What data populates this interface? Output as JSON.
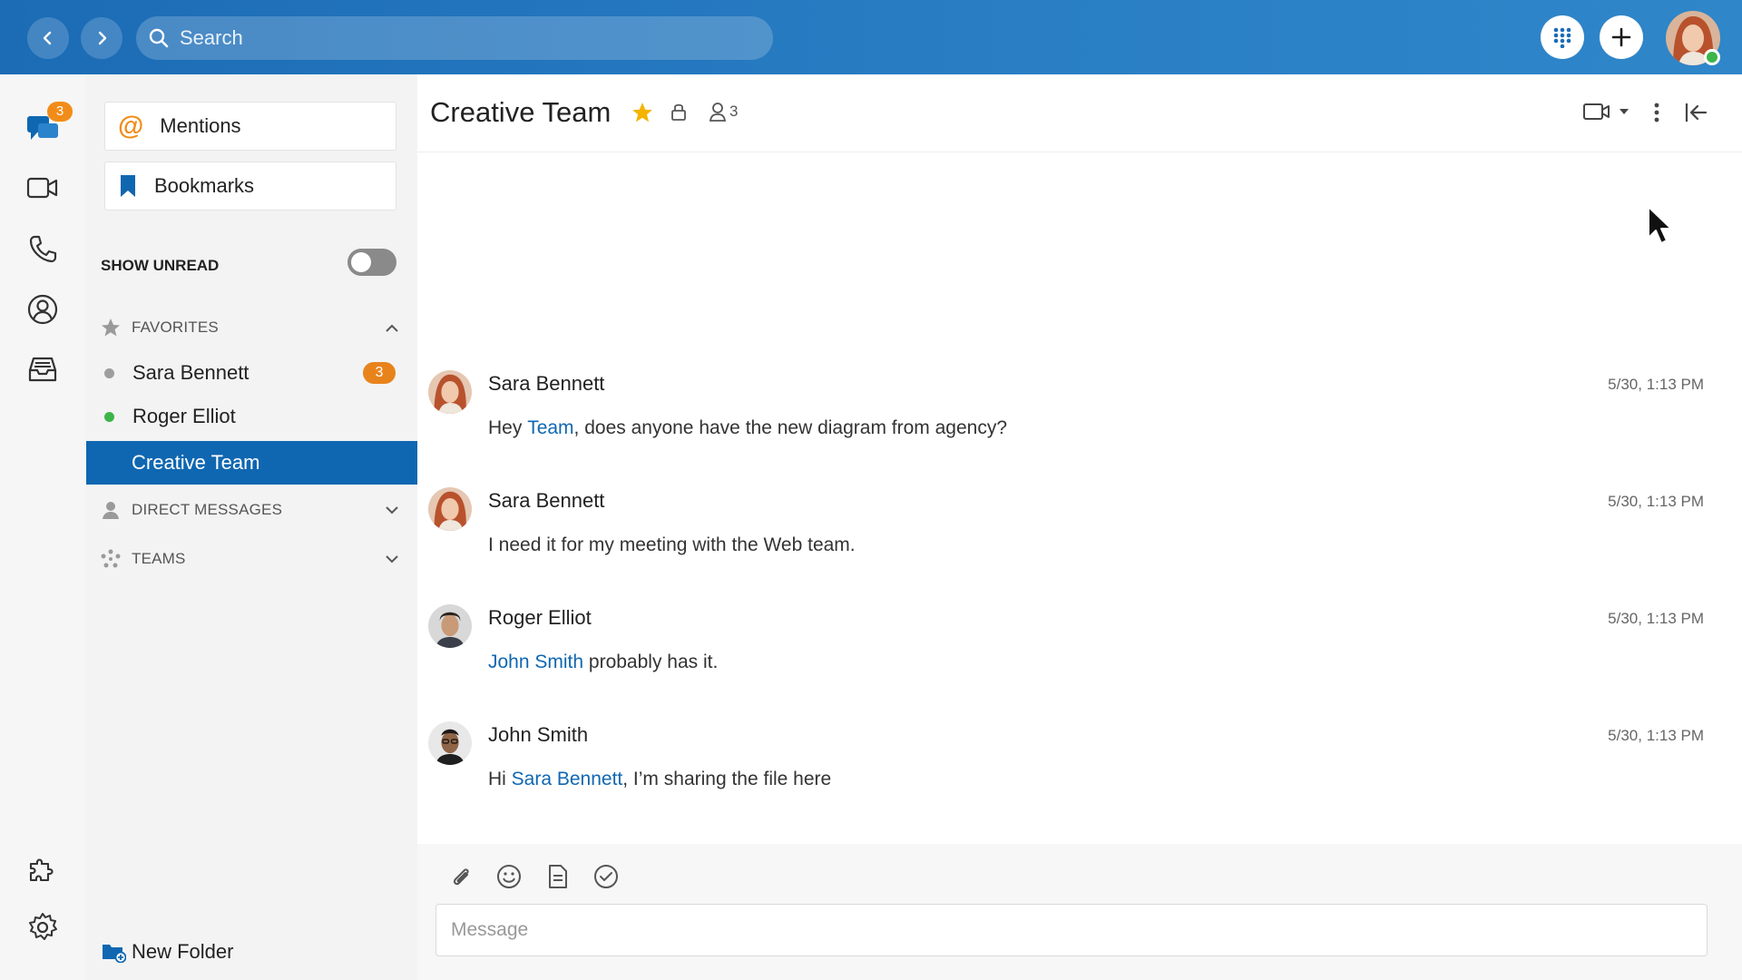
{
  "topbar": {
    "search_placeholder": "Search",
    "user_status_color": "#3db54a"
  },
  "rail": {
    "messages_badge": "3",
    "items": [
      "chat-icon",
      "video-icon",
      "phone-icon",
      "contacts-icon",
      "inbox-icon",
      "puzzle-icon",
      "settings-icon"
    ]
  },
  "sidebar": {
    "mentions_label": "Mentions",
    "bookmarks_label": "Bookmarks",
    "show_unread_label": "SHOW UNREAD",
    "show_unread_on": false,
    "favorites_label": "FAVORITES",
    "favorites": [
      {
        "label": "Sara Bennett",
        "status_color": "#9e9e9e",
        "badge": "3"
      },
      {
        "label": "Roger Elliot",
        "status_color": "#3db54a",
        "badge": ""
      },
      {
        "label": "Creative Team",
        "status_color": "",
        "badge": "",
        "active": true
      }
    ],
    "direct_messages_label": "DIRECT MESSAGES",
    "teams_label": "TEAMS",
    "new_folder_label": "New Folder"
  },
  "channel": {
    "title": "Creative Team",
    "member_count": "3",
    "accent": "#0f67b1",
    "star_color": "#f4b400"
  },
  "messages": [
    {
      "author": "Sara Bennett",
      "time": "5/30, 1:13 PM",
      "pre": "Hey ",
      "mention": "Team",
      "post": ", does anyone have the new diagram from agency?"
    },
    {
      "author": "Sara Bennett",
      "time": "5/30, 1:13 PM",
      "pre": "I need it for my meeting with the Web team.",
      "mention": "",
      "post": ""
    },
    {
      "author": "Roger Elliot",
      "time": "5/30, 1:13 PM",
      "pre": "",
      "mention": "John Smith",
      "post": " probably has it."
    },
    {
      "author": "John Smith",
      "time": "5/30, 1:13 PM",
      "pre": "Hi ",
      "mention": "Sara Bennett",
      "post": ", I’m sharing the file here"
    }
  ],
  "composer": {
    "placeholder": "Message",
    "tools": [
      "attach-icon",
      "emoji-icon",
      "note-icon",
      "check-circle-icon"
    ]
  }
}
